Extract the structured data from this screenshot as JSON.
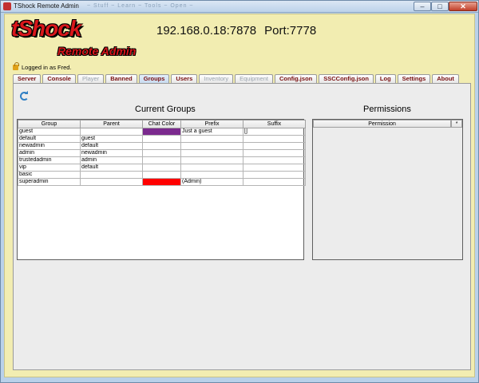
{
  "window": {
    "title": "TShock Remote Admin",
    "ghost_tabs": "~  Stuff  ~  Learn  ~  Tools  ~  Open  ~",
    "buttons": {
      "minimize": "–",
      "maximize": "□",
      "close": "✕"
    }
  },
  "logo": {
    "main": "tShock",
    "sub": "Remote Admin"
  },
  "server": {
    "address": "192.168.0.18:7878",
    "port": "Port:7778"
  },
  "login_status": "Logged in as Fred.",
  "tabs": [
    {
      "label": "Server",
      "state": "enabled"
    },
    {
      "label": "Console",
      "state": "enabled"
    },
    {
      "label": "Player",
      "state": "disabled"
    },
    {
      "label": "Banned",
      "state": "enabled"
    },
    {
      "label": "Groups",
      "state": "active"
    },
    {
      "label": "Users",
      "state": "enabled"
    },
    {
      "label": "Inventory",
      "state": "disabled"
    },
    {
      "label": "Equipment",
      "state": "disabled"
    },
    {
      "label": "Config.json",
      "state": "enabled"
    },
    {
      "label": "SSCConfig.json",
      "state": "enabled"
    },
    {
      "label": "Log",
      "state": "enabled"
    },
    {
      "label": "Settings",
      "state": "enabled"
    },
    {
      "label": "About",
      "state": "enabled"
    }
  ],
  "groups_section": {
    "title": "Current Groups",
    "columns": [
      "Group",
      "Parent",
      "Chat Color",
      "Prefix",
      "Suffix"
    ],
    "rows": [
      {
        "group": "guest",
        "parent": "",
        "chat_color": "#7b2a8e",
        "prefix": "Just a guest",
        "suffix": "[]"
      },
      {
        "group": "default",
        "parent": "guest",
        "chat_color": "",
        "prefix": "",
        "suffix": ""
      },
      {
        "group": "newadmin",
        "parent": "default",
        "chat_color": "",
        "prefix": "",
        "suffix": ""
      },
      {
        "group": "admin",
        "parent": "newadmin",
        "chat_color": "",
        "prefix": "",
        "suffix": ""
      },
      {
        "group": "trustedadmin",
        "parent": "admin",
        "chat_color": "",
        "prefix": "",
        "suffix": ""
      },
      {
        "group": "vip",
        "parent": "default",
        "chat_color": "",
        "prefix": "",
        "suffix": ""
      },
      {
        "group": "basic",
        "parent": "",
        "chat_color": "",
        "prefix": "",
        "suffix": ""
      },
      {
        "group": "superadmin",
        "parent": "",
        "chat_color": "#ff0000",
        "prefix": "(Admin)",
        "suffix": ""
      }
    ]
  },
  "permissions_section": {
    "title": "Permissions",
    "columns": [
      "Permission",
      "*"
    ]
  },
  "colors": {
    "client_bg": "#f2edb1",
    "tab_text": "#7a1010",
    "logo_red": "#d9161b"
  }
}
